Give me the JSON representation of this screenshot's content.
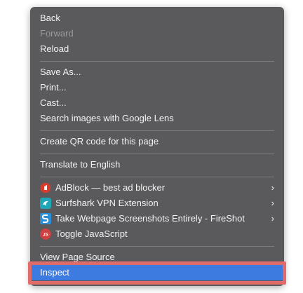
{
  "menu": {
    "back": "Back",
    "forward": "Forward",
    "reload": "Reload",
    "save_as": "Save As...",
    "print": "Print...",
    "cast": "Cast...",
    "search_lens": "Search images with Google Lens",
    "qr_code": "Create QR code for this page",
    "translate": "Translate to English",
    "extensions": [
      {
        "label": "AdBlock — best ad blocker",
        "icon": "adblock-icon",
        "color": "#d93a2b",
        "has_submenu": true
      },
      {
        "label": "Surfshark VPN Extension",
        "icon": "surfshark-icon",
        "color": "#1fa7b8",
        "has_submenu": true
      },
      {
        "label": "Take Webpage Screenshots Entirely - FireShot",
        "icon": "fireshot-icon",
        "color": "#2a8fd6",
        "has_submenu": true
      },
      {
        "label": "Toggle JavaScript",
        "icon": "javascript-toggle-icon",
        "color": "#d04040",
        "has_submenu": false
      }
    ],
    "view_source": "View Page Source",
    "inspect": "Inspect",
    "chevron": "›",
    "js_badge": "JS",
    "highlight_color": "#e06b6b",
    "selected_color": "#3e7be0"
  }
}
